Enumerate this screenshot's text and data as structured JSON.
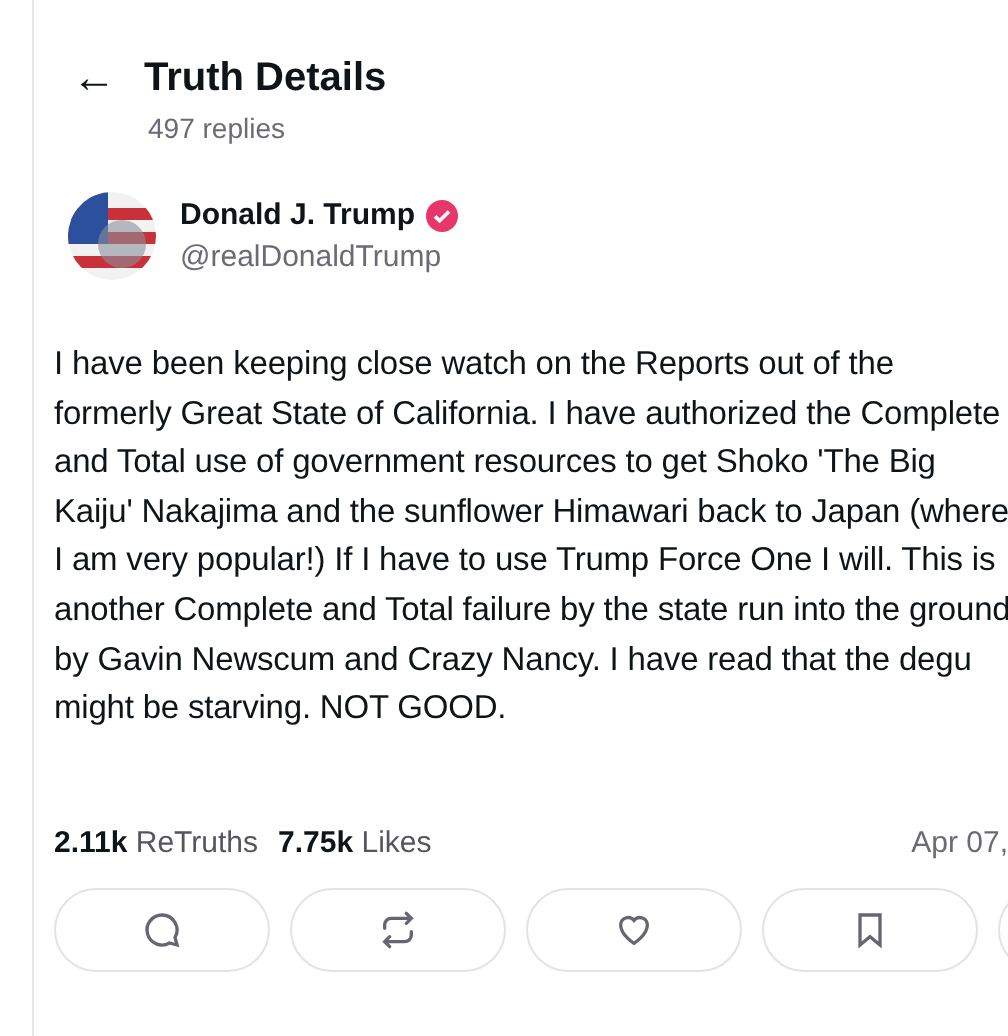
{
  "header": {
    "back": "←",
    "title": "Truth Details",
    "subtitle": "497 replies"
  },
  "post": {
    "author": {
      "name": "Donald J. Trump",
      "handle": "@realDonaldTrump",
      "verified": true
    },
    "text": "I have been keeping close watch on the Reports out of the formerly Great State of California. I have authorized the Complete and Total use of government resources to get Shoko 'The Big Kaiju' Nakajima and the sunflower Himawari back to Japan (where I am very popular!) If I have to use Trump Force One I will. This is another Complete and Total failure by the state run into the ground by Gavin Newscum and Crazy Nancy. I have read that the degu might be starving. NOT GOOD.",
    "stats": [
      "**2.11k** ReTruths",
      "**7.75k** Likes"
    ],
    "date": "Apr 07,",
    "actions": [
      {
        "kind": "reply"
      },
      {
        "kind": "retruth"
      },
      {
        "kind": "like"
      },
      {
        "kind": "bookmark"
      }
    ]
  }
}
